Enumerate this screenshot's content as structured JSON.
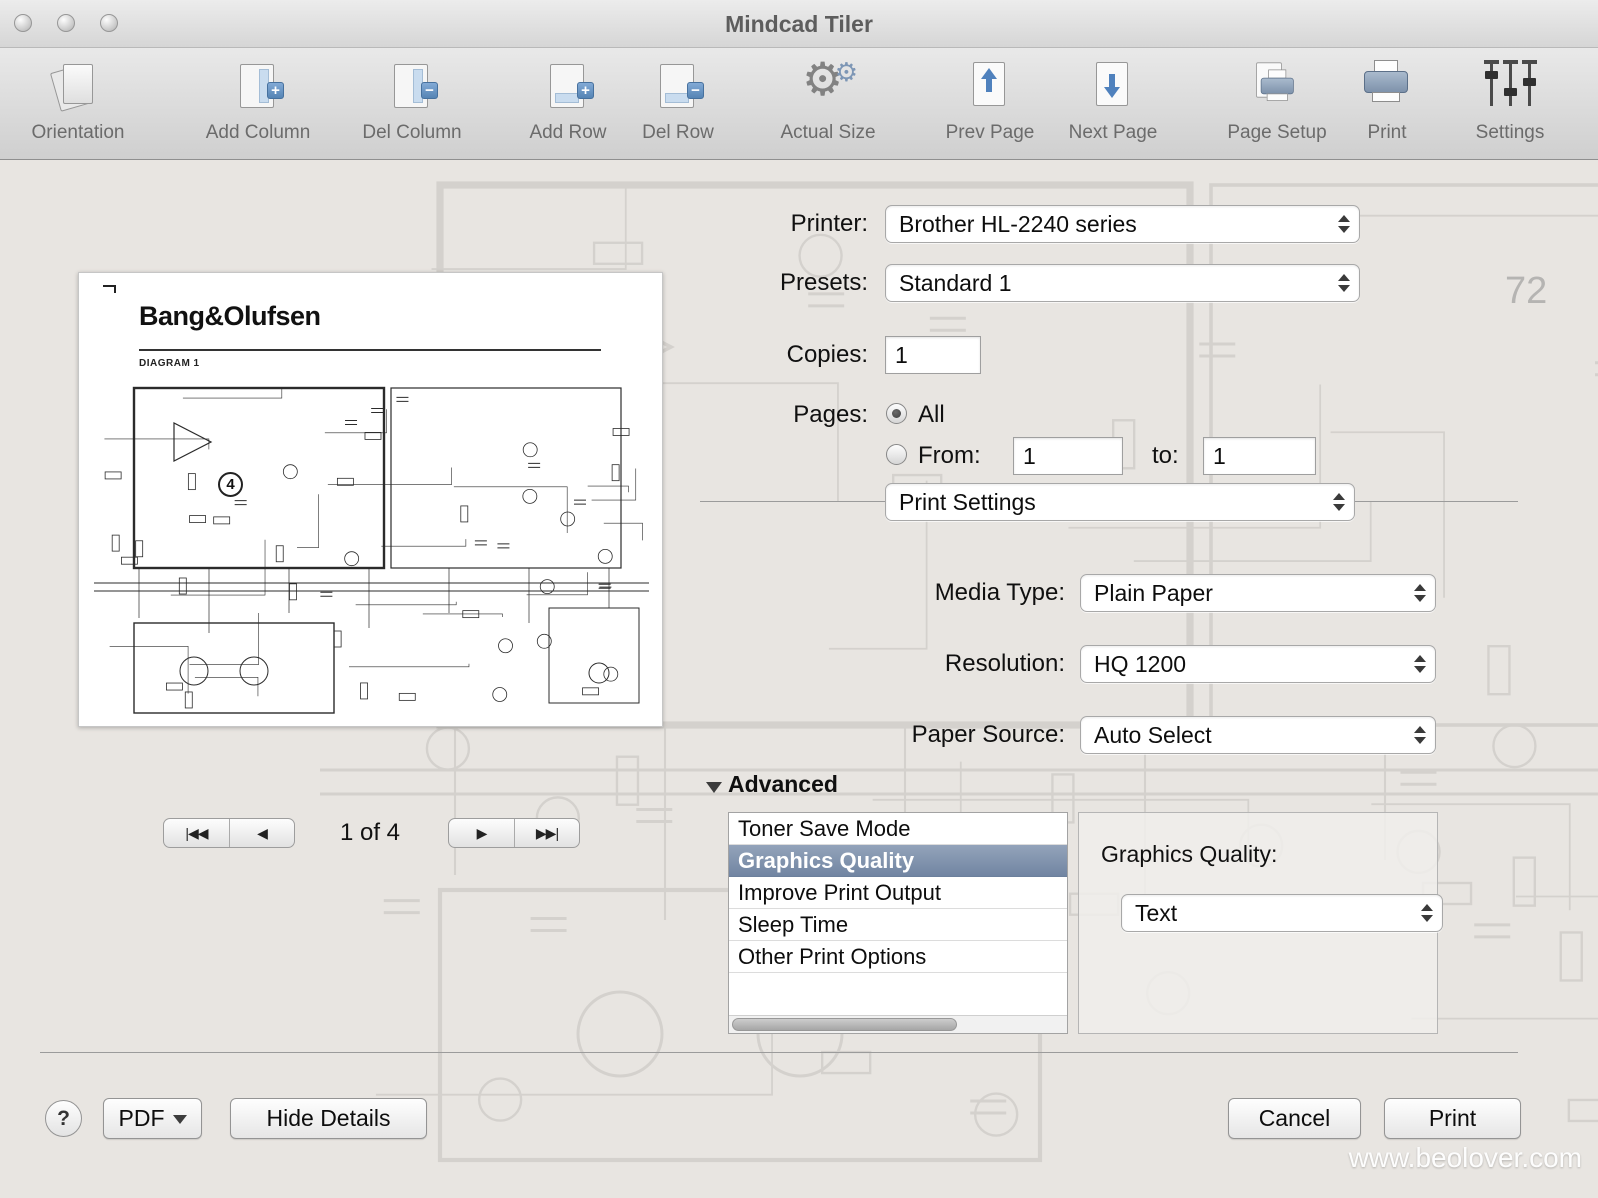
{
  "window": {
    "title": "Mindcad Tiler"
  },
  "background": {
    "page_number": "72"
  },
  "toolbar": {
    "items": [
      {
        "label": "Orientation"
      },
      {
        "label": "Add Column"
      },
      {
        "label": "Del Column"
      },
      {
        "label": "Add Row"
      },
      {
        "label": "Del Row"
      },
      {
        "label": "Actual Size"
      },
      {
        "label": "Prev Page"
      },
      {
        "label": "Next Page"
      },
      {
        "label": "Page Setup"
      },
      {
        "label": "Print"
      },
      {
        "label": "Settings"
      }
    ]
  },
  "preview": {
    "brand": "Bang&Olufsen",
    "diagram_label": "DIAGRAM 1",
    "circled_number": "4",
    "page_indicator": "1 of 4",
    "nav": {
      "first": "|◀◀",
      "prev": "◀",
      "next": "▶",
      "last": "▶▶|"
    }
  },
  "dialog": {
    "printer_label": "Printer:",
    "printer_value": "Brother HL-2240 series",
    "presets_label": "Presets:",
    "presets_value": "Standard 1",
    "copies_label": "Copies:",
    "copies_value": "1",
    "pages_label": "Pages:",
    "pages_all_label": "All",
    "pages_from_label": "From:",
    "pages_from_value": "1",
    "pages_to_label": "to:",
    "pages_to_value": "1",
    "section_value": "Print Settings",
    "media_type_label": "Media Type:",
    "media_type_value": "Plain Paper",
    "resolution_label": "Resolution:",
    "resolution_value": "HQ 1200",
    "paper_source_label": "Paper Source:",
    "paper_source_value": "Auto Select",
    "advanced_label": "Advanced",
    "advanced_options": [
      "Toner Save Mode",
      "Graphics Quality",
      "Improve Print Output",
      "Sleep Time",
      "Other Print Options"
    ],
    "advanced_selected": "Graphics Quality",
    "graphics_quality_label": "Graphics Quality:",
    "graphics_quality_value": "Text",
    "help_label": "?",
    "pdf_label": "PDF",
    "hide_details_label": "Hide Details",
    "cancel_label": "Cancel",
    "print_label": "Print"
  },
  "watermark": "www.beolover.com"
}
